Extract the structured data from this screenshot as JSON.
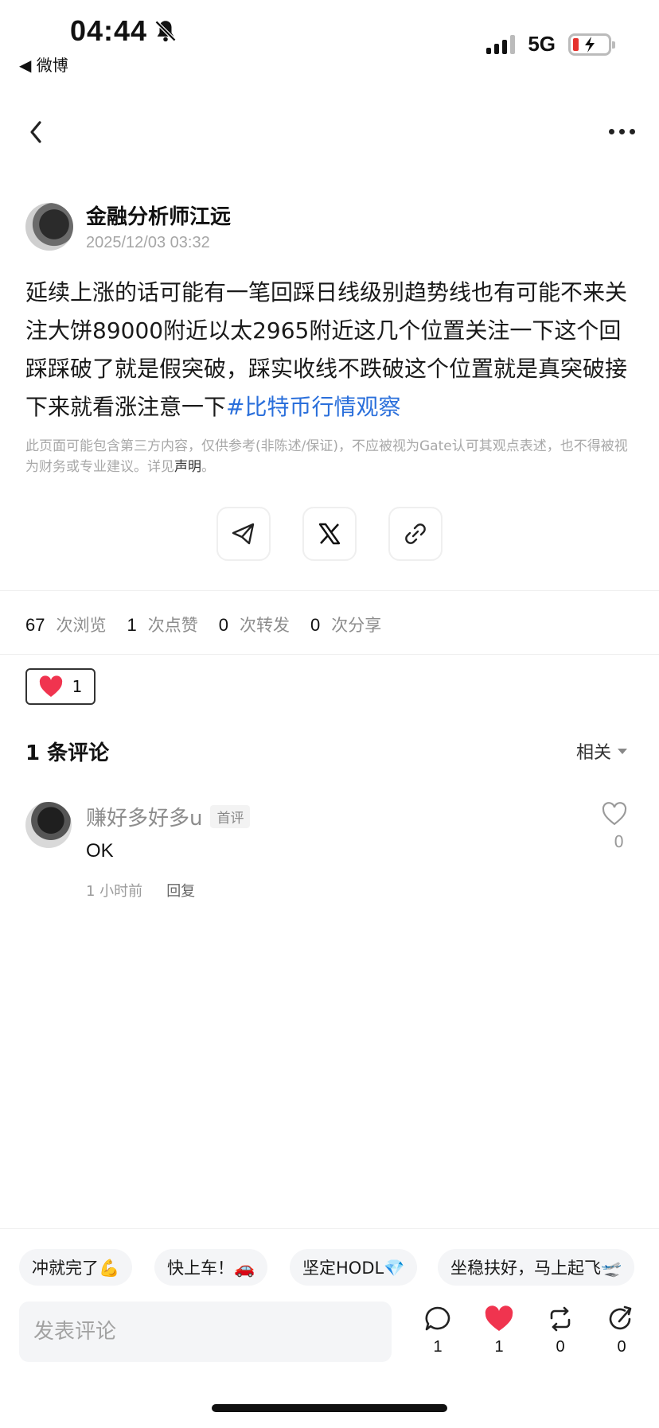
{
  "status_bar": {
    "time": "04:44",
    "back_app": "◀ 微博",
    "network": "5G"
  },
  "author": {
    "name": "金融分析师江远",
    "time": "2025/12/03 03:32"
  },
  "post": {
    "body": "延续上涨的话可能有一笔回踩日线级别趋势线也有可能不来关注大饼89000附近以太2965附近这几个位置关注一下这个回踩踩破了就是假突破，踩实收线不跌破这个位置就是真突破接下来就看涨注意一下",
    "hashtag": "#比特币行情观察"
  },
  "disclaimer": {
    "text": "此页面可能包含第三方内容，仅供参考(非陈述/保证)，不应被视为Gate认可其观点表述，也不得被视为财务或专业建议。详见",
    "link": "声明",
    "end": "。"
  },
  "stats": [
    {
      "num": "67",
      "label": "次浏览"
    },
    {
      "num": "1",
      "label": "次点赞"
    },
    {
      "num": "0",
      "label": "次转发"
    },
    {
      "num": "0",
      "label": "次分享"
    }
  ],
  "like_box": {
    "count": "1"
  },
  "comments": {
    "title": "1 条评论",
    "sort": "相关",
    "items": [
      {
        "name": "赚好多好多u",
        "badge": "首评",
        "text": "OK",
        "time": "1 小时前",
        "reply": "回复",
        "likes": "0"
      }
    ]
  },
  "quick_replies": [
    "冲就完了💪",
    "快上车！🚗",
    "坚定HODL💎",
    "坐稳扶好，马上起飞🛫"
  ],
  "input": {
    "placeholder": "发表评论"
  },
  "actions": {
    "comment": "1",
    "like": "1",
    "repost": "0",
    "share": "0"
  },
  "colors": {
    "accent": "#2a6fdb",
    "like": "#f0344f"
  }
}
